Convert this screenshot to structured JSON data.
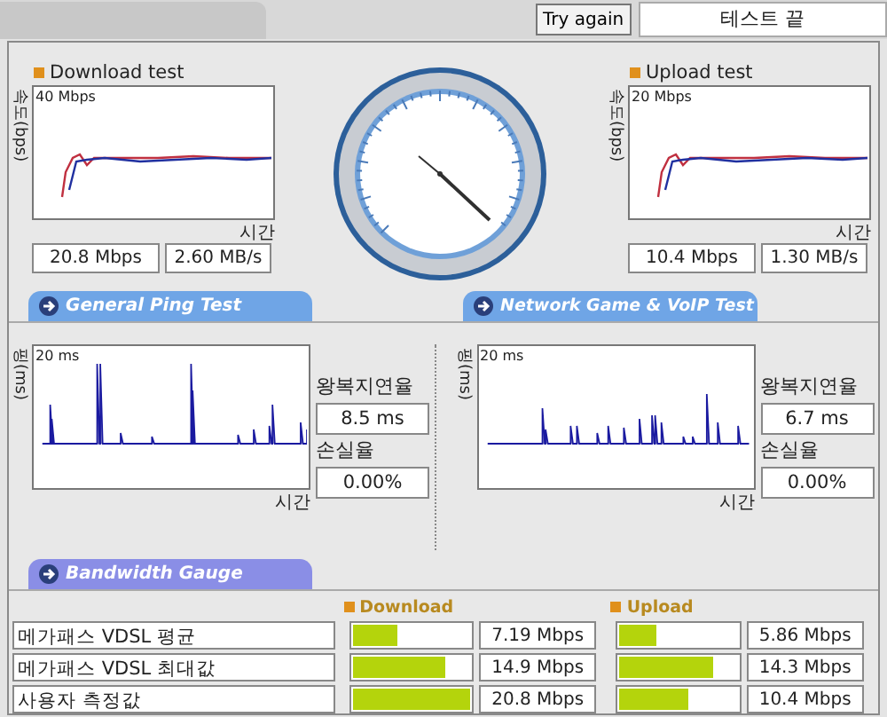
{
  "toolbar": {
    "try_again": "Try again",
    "status": "테스트 끝"
  },
  "speed_tests": [
    {
      "title": "Download test",
      "y_axis": "속도(bps)",
      "scale": "40 Mbps",
      "x_axis": "시간",
      "readings": [
        "20.8 Mbps",
        "2.60 MB/s"
      ]
    },
    {
      "title": "Upload test",
      "y_axis": "속도(bps)",
      "scale": "20 Mbps",
      "x_axis": "시간",
      "readings": [
        "10.4 Mbps",
        "1.30 MB/s"
      ]
    }
  ],
  "section_tabs": [
    {
      "label": "General Ping Test"
    },
    {
      "label": "Network Game & VoIP Test"
    }
  ],
  "ping_tests": [
    {
      "y_axis": "핑(ms)",
      "scale": "20 ms",
      "x_axis": "시간",
      "latency_label": "왕복지연율",
      "latency": "8.5 ms",
      "loss_label": "손실율",
      "loss": "0.00%"
    },
    {
      "y_axis": "핑(ms)",
      "scale": "20 ms",
      "x_axis": "시간",
      "latency_label": "왕복지연율",
      "latency": "6.7 ms",
      "loss_label": "손실율",
      "loss": "0.00%"
    }
  ],
  "bandwidth_tab": {
    "label": "Bandwidth Gauge"
  },
  "bandwidth": {
    "columns": [
      "Download",
      "Upload"
    ],
    "rows": [
      {
        "label": "메가패스 VDSL 평균",
        "download": {
          "level": 0.38,
          "reading": "7.19 Mbps"
        },
        "upload": {
          "level": 0.31,
          "reading": "5.86 Mbps"
        }
      },
      {
        "label": "메가패스 VDSL 최대값",
        "download": {
          "level": 0.79,
          "reading": "14.9 Mbps"
        },
        "upload": {
          "level": 0.79,
          "reading": "14.3 Mbps"
        }
      },
      {
        "label": "사용자 측정값",
        "download": {
          "level": 1.0,
          "reading": "20.8 Mbps"
        },
        "upload": {
          "level": 0.58,
          "reading": "10.4 Mbps"
        }
      }
    ]
  }
}
